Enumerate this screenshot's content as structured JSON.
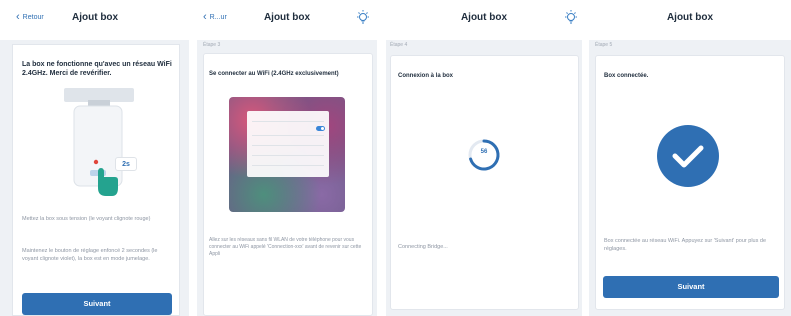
{
  "colors": {
    "accent": "#2f6fb3",
    "background": "#eef1f5",
    "card": "#ffffff",
    "muted_text": "#8e96a3"
  },
  "screen1": {
    "back_label": "Retour",
    "title": "Ajout box",
    "warning": "La box ne fonctionne qu'avec un réseau WiFi 2.4GHz. Merci de revérifier.",
    "timer_badge": "2s",
    "instruction_1": "Mettez la box sous tension (le voyant clignote rouge)",
    "instruction_2": "Maintenez le bouton de réglage enfoncé 2 secondes (le voyant clignote violet), la box est en mode jumelage.",
    "button": "Suivant"
  },
  "screen2": {
    "back_label": "R...ur",
    "title": "Ajout box",
    "bulb_icon": "bulb-icon",
    "step": "Étape 3",
    "card_title": "Se connecter au WiFi (2.4GHz exclusivement)",
    "description": "Allez sur les réseaux sans fil WLAN de votre téléphone pour vous connecter au WiFi appelé 'Connection-xxx' avant de revenir sur cette Appli"
  },
  "screen3": {
    "title": "Ajout box",
    "bulb_icon": "bulb-icon",
    "step": "Étape 4",
    "card_title": "Connexion à la box",
    "progress_label": "56",
    "progress_value": 56,
    "status": "Connecting Bridge..."
  },
  "screen4": {
    "title": "Ajout box",
    "step": "Étape 5",
    "card_title": "Box connectée.",
    "description": "Box connectée au réseau WiFi. Appuyez sur 'Suivant' pour plus de réglages.",
    "button": "Suivant"
  }
}
